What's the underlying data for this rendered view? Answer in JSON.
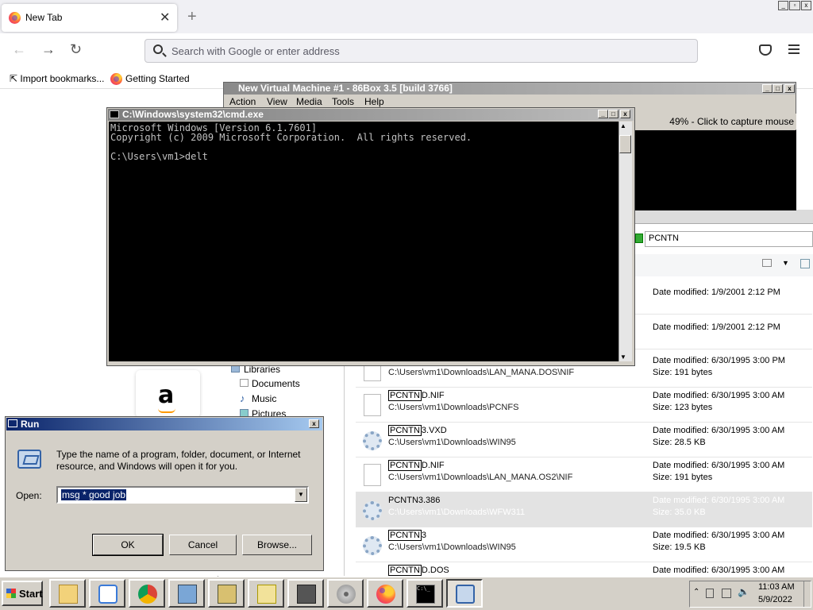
{
  "browser": {
    "tab_title": "New Tab",
    "tab_close": "✕",
    "new_tab": "+",
    "search_placeholder": "Search with Google or enter address",
    "bookmarks": [
      "Import bookmarks...",
      "Getting Started"
    ]
  },
  "vm_window": {
    "title": "New Virtual Machine #1 - 86Box 3.5 [build 3766]",
    "menu": [
      "Action",
      "View",
      "Media",
      "Tools",
      "Help"
    ],
    "status": "49% - Click to capture mouse"
  },
  "cmd_window": {
    "title": "C:\\Windows\\system32\\cmd.exe",
    "lines": [
      "Microsoft Windows [Version 6.1.7601]",
      "Copyright (c) 2009 Microsoft Corporation.  All rights reserved.",
      "",
      "C:\\Users\\vm1>delt"
    ]
  },
  "explorer": {
    "search_text": "PCNTN",
    "nav": [
      "Libraries",
      "Documents",
      "Music",
      "Pictures"
    ],
    "results": [
      {
        "name_hl": "",
        "name_rest": "",
        "path": "",
        "date": "Date modified: 1/9/2001 2:12 PM",
        "size": "",
        "icon": "file"
      },
      {
        "name_hl": "",
        "name_rest": "",
        "path": "",
        "date": "Date modified: 1/9/2001 2:12 PM",
        "size": "",
        "icon": "file"
      },
      {
        "name_hl": "",
        "name_rest": "",
        "path": "C:\\Users\\vm1\\Downloads\\LAN_MANA.DOS\\NIF",
        "date": "Date modified: 6/30/1995 3:00 PM",
        "size": "Size: 191 bytes",
        "icon": "file"
      },
      {
        "name_hl": "PCNTN",
        "name_rest": "D.NIF",
        "path": "C:\\Users\\vm1\\Downloads\\PCNFS",
        "date": "Date modified: 6/30/1995 3:00 AM",
        "size": "Size: 123 bytes",
        "icon": "file"
      },
      {
        "name_hl": "PCNTN",
        "name_rest": "3.VXD",
        "path": "C:\\Users\\vm1\\Downloads\\WIN95",
        "date": "Date modified: 6/30/1995 3:00 AM",
        "size": "Size: 28.5 KB",
        "icon": "gear"
      },
      {
        "name_hl": "PCNTN",
        "name_rest": "D.NIF",
        "path": "C:\\Users\\vm1\\Downloads\\LAN_MANA.OS2\\NIF",
        "date": "Date modified: 6/30/1995 3:00 AM",
        "size": "Size: 191 bytes",
        "icon": "file"
      },
      {
        "name_hl": "",
        "name_rest": "PCNTN3.386",
        "path": "C:\\Users\\vm1\\Downloads\\WFW311",
        "date": "Date modified: 6/30/1995 3:00 AM",
        "size": "Size: 35.0 KB",
        "icon": "gear"
      },
      {
        "name_hl": "PCNTN",
        "name_rest": "3",
        "path": "C:\\Users\\vm1\\Downloads\\WIN95",
        "date": "Date modified: 6/30/1995 3:00 AM",
        "size": "Size: 19.5 KB",
        "icon": "gear"
      },
      {
        "name_hl": "PCNTN",
        "name_rest": "D.DOS",
        "path": "",
        "date": "Date modified: 6/30/1995 3:00 AM",
        "size": "",
        "icon": "file"
      }
    ]
  },
  "run_dialog": {
    "title": "Run",
    "description": "Type the name of a program, folder, document, or Internet resource, and Windows will open it for you.",
    "open_label": "Open:",
    "open_value": "msg * good job",
    "ok": "OK",
    "cancel": "Cancel",
    "browse": "Browse..."
  },
  "taskbar": {
    "start": "Start",
    "time": "11:03 AM",
    "date": "5/9/2022"
  }
}
